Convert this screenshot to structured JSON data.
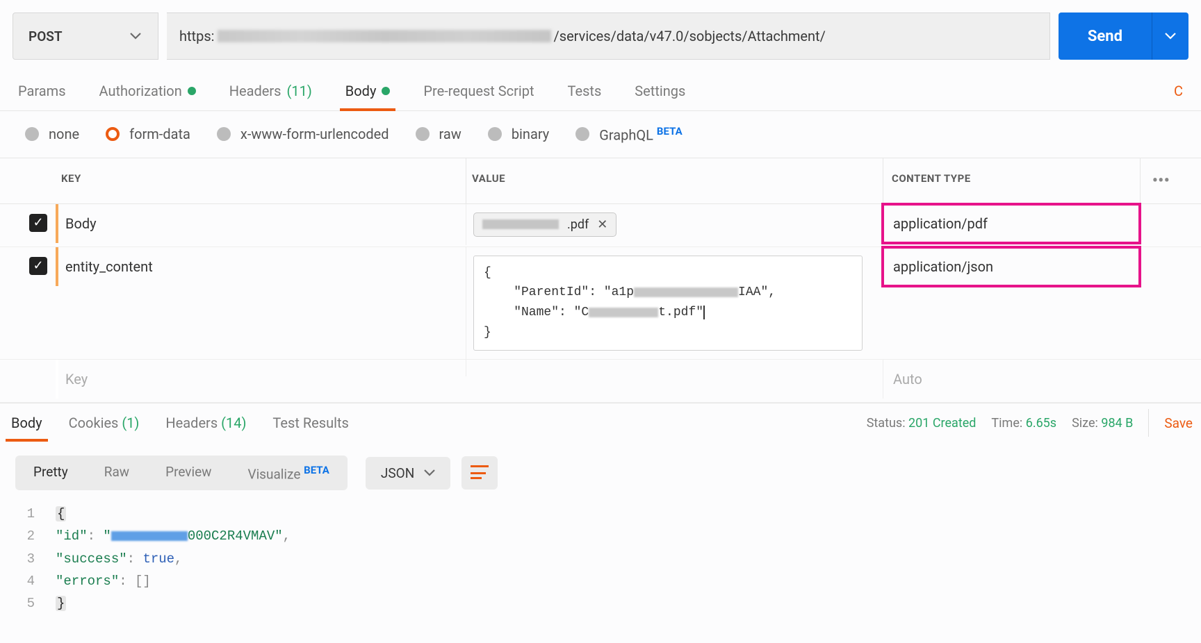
{
  "request": {
    "method": "POST",
    "url_prefix": "https:",
    "url_suffix": "/services/data/v47.0/sobjects/Attachment/",
    "send_label": "Send"
  },
  "tabs": {
    "params": "Params",
    "authorization": "Authorization",
    "headers": "Headers",
    "headers_count": "(11)",
    "body": "Body",
    "prerequest": "Pre-request Script",
    "tests": "Tests",
    "settings": "Settings"
  },
  "body_types": {
    "none": "none",
    "formdata": "form-data",
    "xwww": "x-www-form-urlencoded",
    "raw": "raw",
    "binary": "binary",
    "graphql": "GraphQL",
    "beta": "BETA"
  },
  "table": {
    "hkey": "KEY",
    "hvalue": "VALUE",
    "htype": "CONTENT TYPE",
    "row1_key": "Body",
    "row1_file_ext": ".pdf",
    "row1_type": "application/pdf",
    "row2_key": "entity_content",
    "row2_type": "application/json",
    "row2_json_l1": "{",
    "row2_json_l2a": "    \"ParentId\": \"a1p",
    "row2_json_l2b": "IAA\",",
    "row2_json_l3a": "    \"Name\": \"C",
    "row2_json_l3b": "t.pdf\"",
    "row2_json_l4": "}",
    "key_placeholder": "Key",
    "type_placeholder": "Auto"
  },
  "response": {
    "tab_body": "Body",
    "tab_cookies": "Cookies",
    "cookies_count": "(1)",
    "tab_headers": "Headers",
    "headers_count": "(14)",
    "tab_tests": "Test Results",
    "status_label": "Status:",
    "status_value": "201 Created",
    "time_label": "Time:",
    "time_value": "6.65s",
    "size_label": "Size:",
    "size_value": "984 B",
    "save_label": "Save"
  },
  "pretty": {
    "pretty": "Pretty",
    "raw": "Raw",
    "preview": "Preview",
    "visualize": "Visualize",
    "beta": "BETA",
    "format": "JSON"
  },
  "code": {
    "ln1": "1",
    "ln2": "2",
    "ln3": "3",
    "ln4": "4",
    "ln5": "5",
    "l1": "{",
    "l2a": "    ",
    "l2k": "\"id\"",
    "l2c": ": ",
    "l2v1": "\"",
    "l2v2": "000C2R4VMAV\"",
    "l2e": ",",
    "l3a": "    ",
    "l3k": "\"success\"",
    "l3c": ": ",
    "l3v": "true",
    "l3e": ",",
    "l4a": "    ",
    "l4k": "\"errors\"",
    "l4c": ": ",
    "l4v": "[]",
    "l5": "}"
  }
}
